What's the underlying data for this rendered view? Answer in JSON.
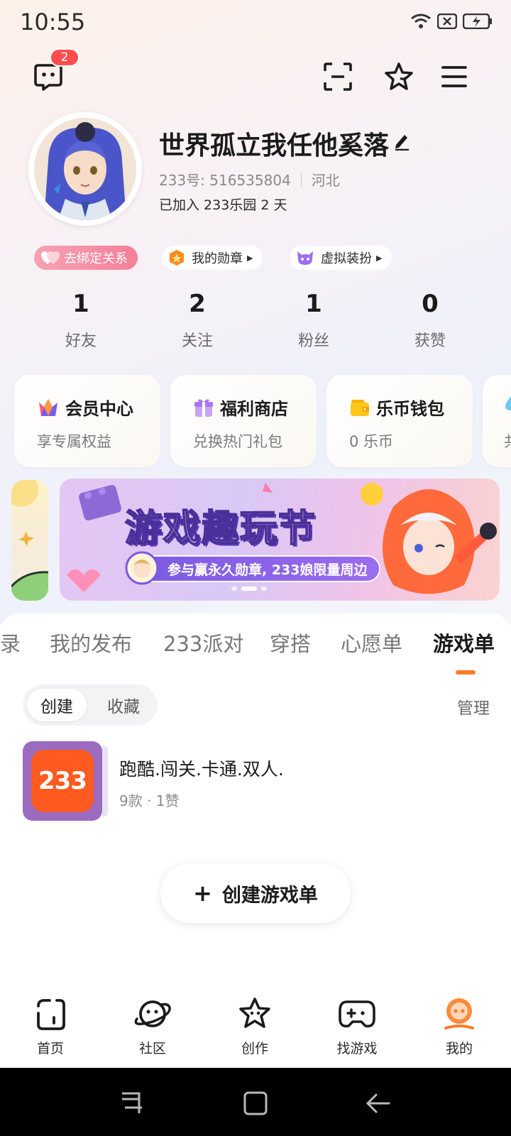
{
  "status_bar": {
    "time": "10:55"
  },
  "header": {
    "message_badge": "2",
    "icons": [
      "chat-icon",
      "scan-icon",
      "star-icon",
      "menu-icon"
    ]
  },
  "profile": {
    "name": "世界孤立我任他奚落",
    "id_label": "233号: 516535804",
    "location": "河北",
    "joined": "已加入 233乐园 2 天"
  },
  "tags": [
    {
      "label": "去绑定关系",
      "icon": "heart-icon"
    },
    {
      "label": "我的勋章",
      "icon": "medal-icon"
    },
    {
      "label": "虚拟装扮",
      "icon": "cat-mask-icon"
    }
  ],
  "stats": [
    {
      "value": "1",
      "label": "好友"
    },
    {
      "value": "2",
      "label": "关注"
    },
    {
      "value": "1",
      "label": "粉丝"
    },
    {
      "value": "0",
      "label": "获赞"
    }
  ],
  "cards": [
    {
      "title": "会员中心",
      "subtitle": "享专属权益",
      "icon": "crown-icon"
    },
    {
      "title": "福利商店",
      "subtitle": "兑换热门礼包",
      "icon": "gift-icon"
    },
    {
      "title": "乐币钱包",
      "subtitle": "0 乐币",
      "icon": "wallet-icon"
    },
    {
      "title": "",
      "subtitle": "共",
      "icon": "drop-icon"
    }
  ],
  "banner": {
    "title": "游戏趣玩节",
    "subtitle": "参与赢永久勋章, 233娘限量周边"
  },
  "tabs": [
    {
      "label": "录",
      "active": false
    },
    {
      "label": "我的发布",
      "active": false
    },
    {
      "label": "233派对",
      "active": false
    },
    {
      "label": "穿搭",
      "active": false
    },
    {
      "label": "心愿单",
      "active": false
    },
    {
      "label": "游戏单",
      "active": true
    }
  ],
  "segment": {
    "options": [
      "创建",
      "收藏"
    ],
    "selected": "创建",
    "manage_label": "管理"
  },
  "game_lists": [
    {
      "title": "跑酷.闯关.卡通.双人.",
      "meta": "9款 · 1赞",
      "thumb_text": "233"
    }
  ],
  "create_button": {
    "label": "创建游戏单"
  },
  "bottom_nav": [
    {
      "label": "首页",
      "icon": "home-icon",
      "active": false
    },
    {
      "label": "社区",
      "icon": "planet-icon",
      "active": false
    },
    {
      "label": "创作",
      "icon": "star-face-icon",
      "active": false
    },
    {
      "label": "找游戏",
      "icon": "gamepad-icon",
      "active": false
    },
    {
      "label": "我的",
      "icon": "profile-face-icon",
      "active": true
    }
  ],
  "colors": {
    "accent": "#ff7a29",
    "badge": "#ff4d4f",
    "active_nav": "#ff7a29"
  }
}
